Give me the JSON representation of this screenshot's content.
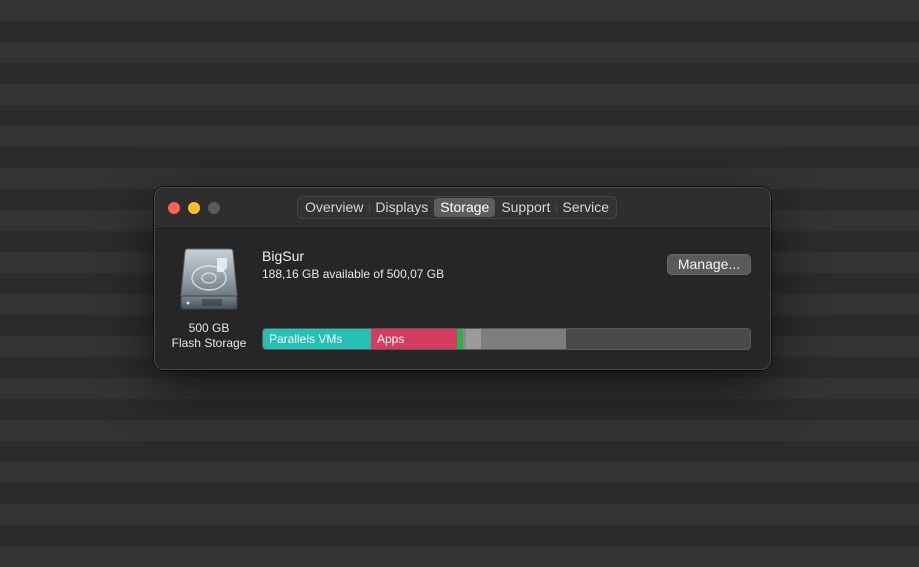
{
  "window": {
    "tabs": [
      {
        "label": "Overview",
        "active": false
      },
      {
        "label": "Displays",
        "active": false
      },
      {
        "label": "Storage",
        "active": true
      },
      {
        "label": "Support",
        "active": false
      },
      {
        "label": "Service",
        "active": false
      }
    ]
  },
  "drive": {
    "icon": "hard-drive-icon",
    "size_label": "500 GB",
    "type_label": "Flash Storage"
  },
  "volume": {
    "name": "BigSur",
    "available_text": "188,16 GB available of 500,07 GB",
    "manage_label": "Manage..."
  },
  "storage_bar": {
    "segments": [
      {
        "label": "Parallels VMs",
        "color": "#25c0b5"
      },
      {
        "label": "Apps",
        "color": "#d43b5f"
      },
      {
        "label": "",
        "color": "#29b34a"
      },
      {
        "label": "",
        "color": "#8a8a8a"
      },
      {
        "label": "",
        "color": "#9b9b9b"
      },
      {
        "label": "",
        "color": "#7d7d7d"
      }
    ],
    "free_color": "#4a4a4a"
  }
}
